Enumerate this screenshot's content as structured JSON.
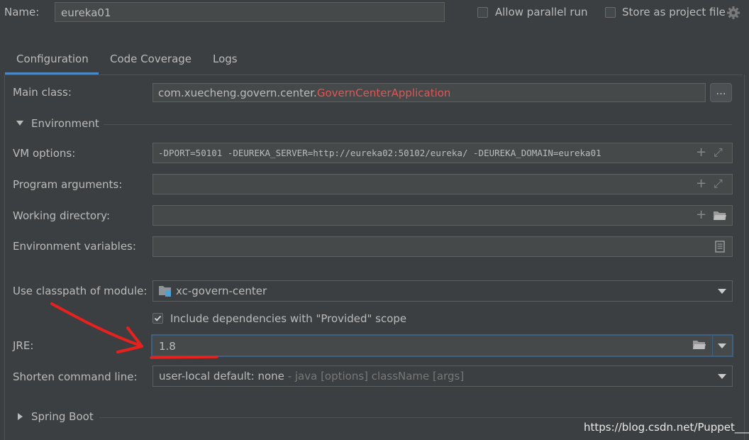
{
  "header": {
    "name_label": "Name:",
    "name_value": "eureka01",
    "allow_parallel_run": "Allow parallel run",
    "store_as_project_file": "Store as project file"
  },
  "tabs": [
    {
      "label": "Configuration",
      "active": true
    },
    {
      "label": "Code Coverage",
      "active": false
    },
    {
      "label": "Logs",
      "active": false
    }
  ],
  "main_class": {
    "label": "Main class:",
    "package": "com.xuecheng.govern.center.",
    "class_name": "GovernCenterApplication",
    "class_color": "#e05555",
    "browse_label": "..."
  },
  "environment": {
    "section_label": "Environment",
    "vm_options_label": "VM options:",
    "vm_options_value": "-DPORT=50101 -DEUREKA_SERVER=http://eureka02:50102/eureka/ -DEUREKA_DOMAIN=eureka01",
    "program_arguments_label": "Program arguments:",
    "program_arguments_value": "",
    "working_directory_label": "Working directory:",
    "working_directory_value": "",
    "environment_variables_label": "Environment variables:",
    "environment_variables_value": ""
  },
  "classpath": {
    "label": "Use classpath of module:",
    "module": "xc-govern-center",
    "include_deps_label": "Include dependencies with \"Provided\" scope",
    "include_deps_checked": true
  },
  "jre": {
    "label": "JRE:",
    "value": "1.8",
    "focus_color": "#3d6185"
  },
  "shorten": {
    "label": "Shorten command line:",
    "value": "user-local default: none",
    "hint": " - java [options] className [args]"
  },
  "spring_boot": {
    "label": "Spring Boot"
  },
  "watermark": "https://blog.csdn.net/Puppet___",
  "annotation_color": "#e8211e"
}
